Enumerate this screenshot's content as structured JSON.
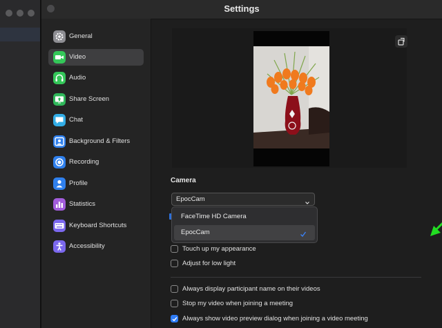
{
  "window": {
    "title": "Settings"
  },
  "sidebar": {
    "items": [
      {
        "label": "General",
        "icon": "gear-icon",
        "color": "#8e8e93",
        "active": false
      },
      {
        "label": "Video",
        "icon": "video-camera-icon",
        "color": "#34c759",
        "active": true
      },
      {
        "label": "Audio",
        "icon": "headphones-icon",
        "color": "#34c759",
        "active": false
      },
      {
        "label": "Share Screen",
        "icon": "share-screen-icon",
        "color": "#30b85a",
        "active": false
      },
      {
        "label": "Chat",
        "icon": "chat-bubble-icon",
        "color": "#32ade6",
        "active": false
      },
      {
        "label": "Background & Filters",
        "icon": "portrait-icon",
        "color": "#2f80ed",
        "active": false
      },
      {
        "label": "Recording",
        "icon": "record-icon",
        "color": "#2f80ed",
        "active": false
      },
      {
        "label": "Profile",
        "icon": "person-icon",
        "color": "#2f80ed",
        "active": false
      },
      {
        "label": "Statistics",
        "icon": "bar-chart-icon",
        "color": "#a25ddc",
        "active": false
      },
      {
        "label": "Keyboard Shortcuts",
        "icon": "keyboard-icon",
        "color": "#7b68ee",
        "active": false
      },
      {
        "label": "Accessibility",
        "icon": "accessibility-icon",
        "color": "#7b68ee",
        "active": false
      }
    ]
  },
  "camera": {
    "section_label": "Camera",
    "selected": "EpocCam",
    "options": [
      {
        "label": "FaceTime HD Camera",
        "selected": false
      },
      {
        "label": "EpocCam",
        "selected": true
      }
    ]
  },
  "options": [
    {
      "label": "Touch up my appearance",
      "checked": false
    },
    {
      "label": "Adjust for low light",
      "checked": false
    },
    {
      "label": "Always display participant name on their videos",
      "checked": false
    },
    {
      "label": "Stop my video when joining a meeting",
      "checked": false
    },
    {
      "label": "Always show video preview dialog when joining a video meeting",
      "checked": true
    }
  ],
  "colors": {
    "accent": "#2f7cf6",
    "annotation_arrow": "#22dd22"
  }
}
